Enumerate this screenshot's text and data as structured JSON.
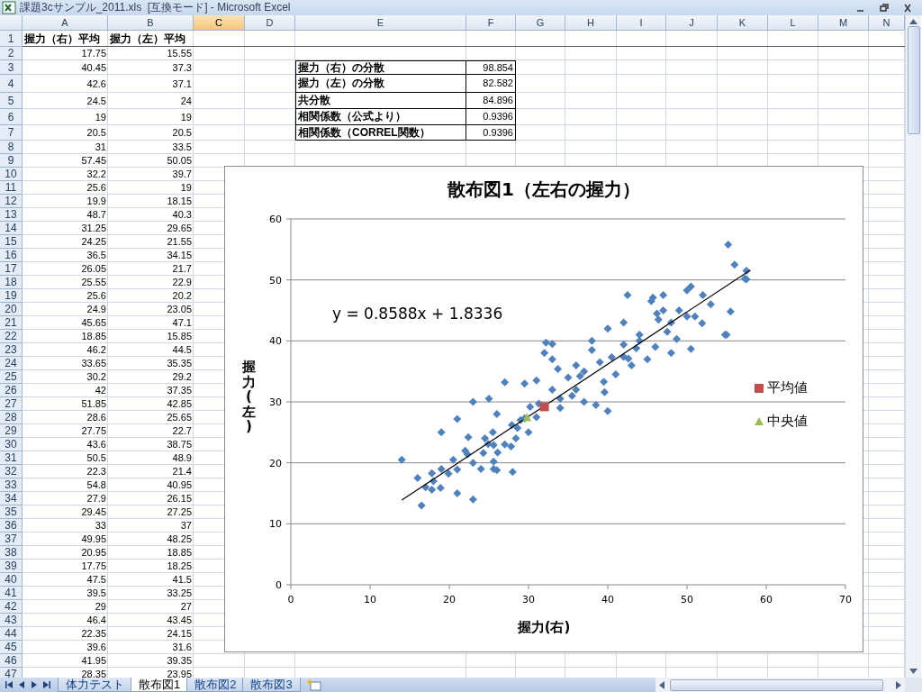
{
  "window": {
    "title": "課題3cサンプル_2011.xls  [互換モード] - Microsoft Excel"
  },
  "sheet": {
    "columns": [
      {
        "label": "A",
        "selected": false
      },
      {
        "label": "B",
        "selected": false
      },
      {
        "label": "C",
        "selected": true
      },
      {
        "label": "D",
        "selected": false
      },
      {
        "label": "E",
        "selected": false
      },
      {
        "label": "F",
        "selected": false
      },
      {
        "label": "G",
        "selected": false
      },
      {
        "label": "H",
        "selected": false
      },
      {
        "label": "I",
        "selected": false
      },
      {
        "label": "J",
        "selected": false
      },
      {
        "label": "K",
        "selected": false
      },
      {
        "label": "L",
        "selected": false
      },
      {
        "label": "M",
        "selected": false
      },
      {
        "label": "N",
        "selected": false
      }
    ],
    "rows": [
      {
        "number": "1",
        "cells": {
          "A": "握力（右）平均",
          "B": "握力（左）平均"
        }
      },
      {
        "number": "2",
        "cells": {
          "A": "17.75",
          "B": "15.55"
        }
      },
      {
        "number": "3",
        "cells": {
          "A": "40.45",
          "B": "37.3",
          "E": "握力（右）の分散",
          "F": "98.854"
        }
      },
      {
        "number": "4",
        "cells": {
          "A": "42.6",
          "B": "37.1",
          "E": "握力（左）の分散",
          "F": "82.582"
        }
      },
      {
        "number": "5",
        "cells": {
          "A": "24.5",
          "B": "24",
          "E": "共分散",
          "F": "84.896"
        }
      },
      {
        "number": "6",
        "cells": {
          "A": "19",
          "B": "19",
          "E": "相関係数（公式より）",
          "F": "0.9396"
        }
      },
      {
        "number": "7",
        "cells": {
          "A": "20.5",
          "B": "20.5",
          "E": "相関係数（CORREL関数）",
          "F": "0.9396"
        }
      },
      {
        "number": "8",
        "cells": {
          "A": "31",
          "B": "33.5"
        }
      },
      {
        "number": "9",
        "cells": {
          "A": "57.45",
          "B": "50.05"
        }
      },
      {
        "number": "10",
        "cells": {
          "A": "32.2",
          "B": "39.7"
        }
      },
      {
        "number": "11",
        "cells": {
          "A": "25.6",
          "B": "19"
        }
      },
      {
        "number": "12",
        "cells": {
          "A": "19.9",
          "B": "18.15"
        }
      },
      {
        "number": "13",
        "cells": {
          "A": "48.7",
          "B": "40.3"
        }
      },
      {
        "number": "14",
        "cells": {
          "A": "31.25",
          "B": "29.65"
        }
      },
      {
        "number": "15",
        "cells": {
          "A": "24.25",
          "B": "21.55"
        }
      },
      {
        "number": "16",
        "cells": {
          "A": "36.5",
          "B": "34.15"
        }
      },
      {
        "number": "17",
        "cells": {
          "A": "26.05",
          "B": "21.7"
        }
      },
      {
        "number": "18",
        "cells": {
          "A": "25.55",
          "B": "22.9"
        }
      },
      {
        "number": "19",
        "cells": {
          "A": "25.6",
          "B": "20.2"
        }
      },
      {
        "number": "20",
        "cells": {
          "A": "24.9",
          "B": "23.05"
        }
      },
      {
        "number": "21",
        "cells": {
          "A": "45.65",
          "B": "47.1"
        }
      },
      {
        "number": "22",
        "cells": {
          "A": "18.85",
          "B": "15.85"
        }
      },
      {
        "number": "23",
        "cells": {
          "A": "46.2",
          "B": "44.5"
        }
      },
      {
        "number": "24",
        "cells": {
          "A": "33.65",
          "B": "35.35"
        }
      },
      {
        "number": "25",
        "cells": {
          "A": "30.2",
          "B": "29.2"
        }
      },
      {
        "number": "26",
        "cells": {
          "A": "42",
          "B": "37.35"
        }
      },
      {
        "number": "27",
        "cells": {
          "A": "51.85",
          "B": "42.85"
        }
      },
      {
        "number": "28",
        "cells": {
          "A": "28.6",
          "B": "25.65"
        }
      },
      {
        "number": "29",
        "cells": {
          "A": "27.75",
          "B": "22.7"
        }
      },
      {
        "number": "30",
        "cells": {
          "A": "43.6",
          "B": "38.75"
        }
      },
      {
        "number": "31",
        "cells": {
          "A": "50.5",
          "B": "48.9"
        }
      },
      {
        "number": "32",
        "cells": {
          "A": "22.3",
          "B": "21.4"
        }
      },
      {
        "number": "33",
        "cells": {
          "A": "54.8",
          "B": "40.95"
        }
      },
      {
        "number": "34",
        "cells": {
          "A": "27.9",
          "B": "26.15"
        }
      },
      {
        "number": "35",
        "cells": {
          "A": "29.45",
          "B": "27.25"
        }
      },
      {
        "number": "36",
        "cells": {
          "A": "33",
          "B": "37"
        }
      },
      {
        "number": "37",
        "cells": {
          "A": "49.95",
          "B": "48.25"
        }
      },
      {
        "number": "38",
        "cells": {
          "A": "20.95",
          "B": "18.85"
        }
      },
      {
        "number": "39",
        "cells": {
          "A": "17.75",
          "B": "18.25"
        }
      },
      {
        "number": "40",
        "cells": {
          "A": "47.5",
          "B": "41.5"
        }
      },
      {
        "number": "41",
        "cells": {
          "A": "39.5",
          "B": "33.25"
        }
      },
      {
        "number": "42",
        "cells": {
          "A": "29",
          "B": "27"
        }
      },
      {
        "number": "43",
        "cells": {
          "A": "46.4",
          "B": "43.45"
        }
      },
      {
        "number": "44",
        "cells": {
          "A": "22.35",
          "B": "24.15"
        }
      },
      {
        "number": "45",
        "cells": {
          "A": "39.6",
          "B": "31.6"
        }
      },
      {
        "number": "46",
        "cells": {
          "A": "41.95",
          "B": "39.35"
        }
      },
      {
        "number": "47",
        "cells": {
          "A": "28.35",
          "B": "23.95"
        }
      }
    ]
  },
  "chart": {
    "chart_data": {
      "type": "scatter",
      "title": "散布図1（左右の握力）",
      "xlabel": "握力(右)",
      "ylabel": "握力(左)",
      "xlim": [
        0,
        70
      ],
      "ylim": [
        0,
        60
      ],
      "xticks": [
        {
          "value": 0,
          "label": "0"
        },
        {
          "value": 10,
          "label": "10"
        },
        {
          "value": 20,
          "label": "20"
        },
        {
          "value": 30,
          "label": "30"
        },
        {
          "value": 40,
          "label": "40"
        },
        {
          "value": 50,
          "label": "50"
        },
        {
          "value": 60,
          "label": "60"
        },
        {
          "value": 70,
          "label": "70"
        }
      ],
      "yticks": [
        {
          "value": 0,
          "label": "0"
        },
        {
          "value": 10,
          "label": "10"
        },
        {
          "value": 20,
          "label": "20"
        },
        {
          "value": 30,
          "label": "30"
        },
        {
          "value": 40,
          "label": "40"
        },
        {
          "value": 50,
          "label": "50"
        },
        {
          "value": 60,
          "label": "60"
        }
      ],
      "grid": true,
      "legend": true,
      "series": [
        {
          "marker": "diamond",
          "color": "#4f81bd",
          "x": [
            17.8,
            40.5,
            42.6,
            24.5,
            19,
            20.5,
            31,
            57.5,
            32.2,
            25.6,
            19.9,
            48.7,
            31.3,
            24.3,
            36.5,
            26.1,
            25.6,
            25.6,
            24.9,
            45.7,
            18.9,
            46.2,
            33.7,
            30.2,
            42,
            51.9,
            28.6,
            27.8,
            43.6,
            50.5,
            22.3,
            54.8,
            27.9,
            29.5,
            33,
            50,
            21,
            17.8,
            47.5,
            39.5,
            29,
            46.4,
            22.4,
            39.6,
            42,
            28.4,
            14,
            16.5,
            55.2,
            56,
            57.5,
            57.3,
            55.5,
            55,
            52,
            50.5,
            42.5,
            45.5,
            47,
            40,
            38,
            33,
            32,
            23,
            21,
            19,
            18,
            16,
            17,
            21,
            25,
            23,
            27,
            29.5,
            34,
            35.5,
            37,
            38.5,
            40,
            36,
            38,
            44,
            48,
            49,
            51,
            53,
            48,
            45,
            43,
            41,
            36,
            34,
            26,
            22,
            23,
            24,
            26,
            28,
            27,
            25.5,
            30,
            31,
            33,
            35,
            37,
            39,
            44,
            46,
            42,
            47,
            50
          ],
          "values": [
            15.6,
            37.3,
            37.1,
            24,
            19,
            20.5,
            33.5,
            50.1,
            39.7,
            19,
            18.2,
            40.3,
            29.7,
            21.6,
            34.2,
            21.7,
            22.9,
            20.2,
            23.1,
            47.1,
            15.9,
            44.5,
            35.4,
            29.2,
            37.4,
            42.9,
            25.7,
            22.7,
            38.8,
            48.9,
            21.4,
            41,
            26.2,
            27.3,
            37,
            48.3,
            18.9,
            18.3,
            41.5,
            33.3,
            27,
            43.5,
            24.2,
            31.6,
            39.4,
            24,
            20.5,
            13,
            55.8,
            52.5,
            51.5,
            50.2,
            44.8,
            41,
            47.5,
            38.7,
            47.5,
            46.5,
            47.5,
            42,
            40,
            39.5,
            38,
            14,
            15,
            25,
            17,
            17.5,
            16,
            27.2,
            30.5,
            30,
            33.2,
            33,
            29,
            31,
            30,
            29.5,
            28.5,
            36,
            38.5,
            41,
            43,
            45,
            44,
            46,
            38,
            37,
            36,
            34.5,
            32,
            30.5,
            28,
            22,
            20,
            19,
            18.8,
            18.5,
            23,
            25,
            25,
            27.5,
            32,
            34,
            35,
            36.5,
            40,
            39,
            43,
            45,
            44
          ]
        },
        {
          "type": "line",
          "color": "#000000",
          "x": [
            14,
            58
          ],
          "values": [
            13.9,
            51.6
          ]
        },
        {
          "name": "平均値",
          "marker": "square",
          "color": "#c0504d",
          "x": [
            32
          ],
          "values": [
            29.2
          ]
        },
        {
          "name": "中央値",
          "marker": "triangle",
          "color": "#9bbb59",
          "x": [
            29.8
          ],
          "values": [
            27.4
          ]
        }
      ],
      "annotations": [
        {
          "text": "y = 0.8588x + 1.8336"
        }
      ]
    }
  },
  "sheet_tabs": [
    {
      "label": "体力テスト",
      "selected": false
    },
    {
      "label": "散布図1",
      "selected": true
    },
    {
      "label": "散布図2",
      "selected": false
    },
    {
      "label": "散布図3",
      "selected": false
    }
  ]
}
